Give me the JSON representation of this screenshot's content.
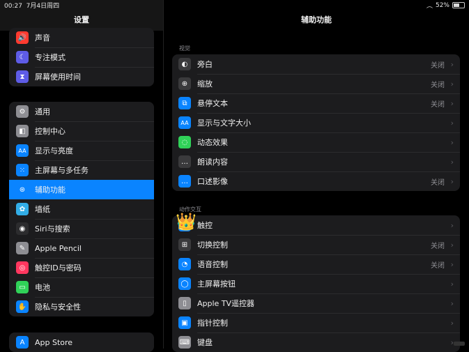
{
  "status": {
    "time": "00:27",
    "date": "7月4日周四",
    "wifi": "wifi-icon",
    "battery": "52%"
  },
  "sidebar": {
    "title": "设置",
    "group1": [
      {
        "label": "声音",
        "icon": "speaker-icon",
        "color": "#ff3b30",
        "glyph": "🔊"
      },
      {
        "label": "专注模式",
        "icon": "moon-icon",
        "color": "#5e5ce6",
        "glyph": "☾"
      },
      {
        "label": "屏幕使用时间",
        "icon": "hourglass-icon",
        "color": "#5e5ce6",
        "glyph": "⧗"
      }
    ],
    "group2": [
      {
        "label": "通用",
        "icon": "gear-icon",
        "color": "#8e8e93",
        "glyph": "⚙"
      },
      {
        "label": "控制中心",
        "icon": "toggles-icon",
        "color": "#8e8e93",
        "glyph": "◧"
      },
      {
        "label": "显示与亮度",
        "icon": "text-size-icon",
        "color": "#0a84ff",
        "glyph": "AA"
      },
      {
        "label": "主屏幕与多任务",
        "icon": "grid-icon",
        "color": "#0a84ff",
        "glyph": "⁙"
      },
      {
        "label": "辅助功能",
        "icon": "accessibility-icon",
        "color": "#0a84ff",
        "glyph": "⊛",
        "selected": true
      },
      {
        "label": "墙纸",
        "icon": "wallpaper-icon",
        "color": "#32ade6",
        "glyph": "✿"
      },
      {
        "label": "Siri与搜索",
        "icon": "siri-icon",
        "color": "#2c2c2e",
        "glyph": "◉"
      },
      {
        "label": "Apple Pencil",
        "icon": "pencil-icon",
        "color": "#8e8e93",
        "glyph": "✎"
      },
      {
        "label": "触控ID与密码",
        "icon": "fingerprint-icon",
        "color": "#ff375f",
        "glyph": "◎"
      },
      {
        "label": "电池",
        "icon": "battery-icon",
        "color": "#30d158",
        "glyph": "▭"
      },
      {
        "label": "隐私与安全性",
        "icon": "hand-icon",
        "color": "#0a84ff",
        "glyph": "✋"
      }
    ],
    "group3": [
      {
        "label": "App Store",
        "icon": "appstore-icon",
        "color": "#0a84ff",
        "glyph": "A"
      }
    ]
  },
  "main": {
    "title": "辅助功能",
    "section1": "视觉",
    "rows1": [
      {
        "label": "旁白",
        "value": "关闭",
        "icon": "voiceover-icon",
        "color": "#3a3a3c",
        "glyph": "◐"
      },
      {
        "label": "缩放",
        "value": "关闭",
        "icon": "zoom-icon",
        "color": "#3a3a3c",
        "glyph": "⊕"
      },
      {
        "label": "悬停文本",
        "value": "关闭",
        "icon": "hover-text-icon",
        "color": "#0a84ff",
        "glyph": "⧉"
      },
      {
        "label": "显示与文字大小",
        "value": "",
        "icon": "text-size-icon",
        "color": "#0a84ff",
        "glyph": "AA"
      },
      {
        "label": "动态效果",
        "value": "",
        "icon": "motion-icon",
        "color": "#30d158",
        "glyph": "◌"
      },
      {
        "label": "朗读内容",
        "value": "",
        "icon": "speech-bubble-icon",
        "color": "#3a3a3c",
        "glyph": "…"
      },
      {
        "label": "口述影像",
        "value": "关闭",
        "icon": "audio-description-icon",
        "color": "#0a84ff",
        "glyph": "…"
      }
    ],
    "section2": "动作交互",
    "rows2": [
      {
        "label": "触控",
        "value": "",
        "icon": "touch-icon",
        "color": "#0a84ff",
        "glyph": ""
      },
      {
        "label": "切换控制",
        "value": "关闭",
        "icon": "switch-control-icon",
        "color": "#3a3a3c",
        "glyph": "⊞"
      },
      {
        "label": "语音控制",
        "value": "关闭",
        "icon": "voice-control-icon",
        "color": "#0a84ff",
        "glyph": "◔"
      },
      {
        "label": "主屏幕按钮",
        "value": "",
        "icon": "home-button-icon",
        "color": "#0a84ff",
        "glyph": "◯"
      },
      {
        "label": "Apple TV遥控器",
        "value": "",
        "icon": "remote-icon",
        "color": "#8e8e93",
        "glyph": "▯"
      },
      {
        "label": "指针控制",
        "value": "",
        "icon": "pointer-icon",
        "color": "#0a84ff",
        "glyph": "▣"
      },
      {
        "label": "键盘",
        "value": "",
        "icon": "keyboard-icon",
        "color": "#8e8e93",
        "glyph": "⌨"
      }
    ]
  }
}
